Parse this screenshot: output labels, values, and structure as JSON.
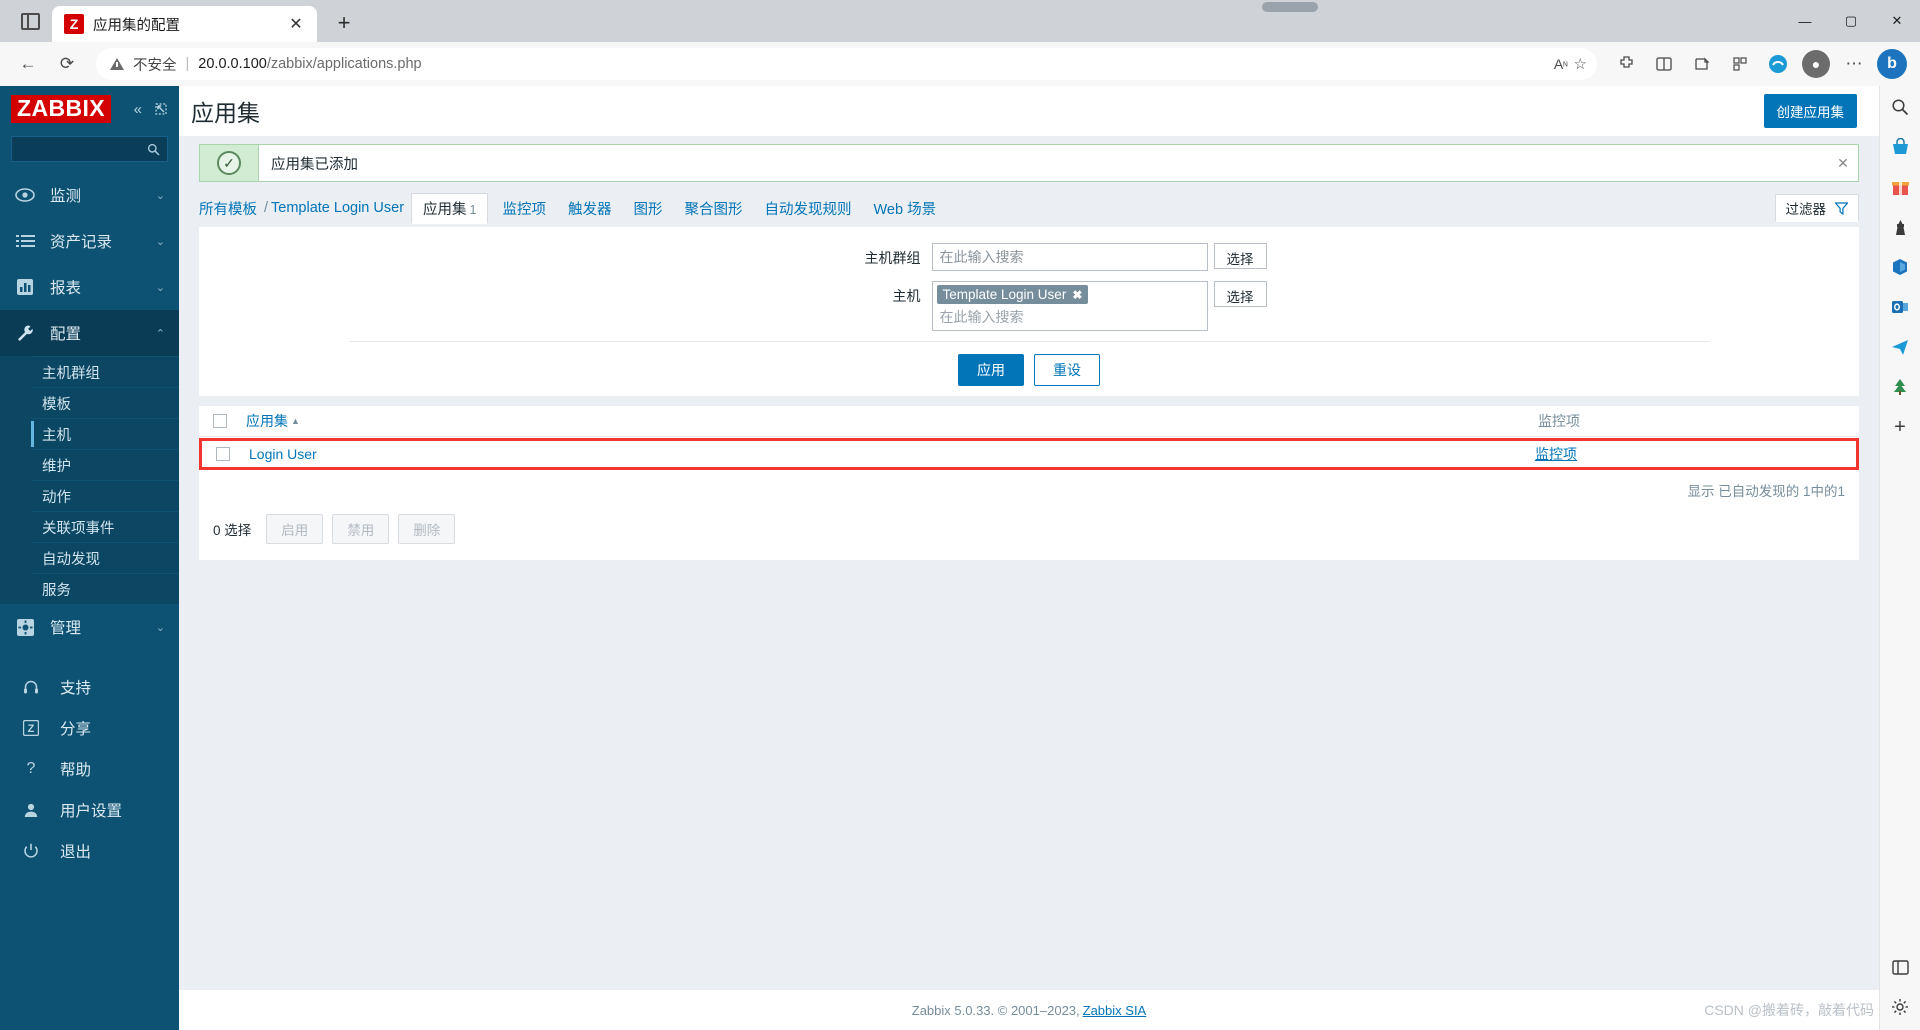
{
  "browser": {
    "tab": {
      "favicon_letter": "Z",
      "title": "应用集的配置",
      "close_label": "✕"
    },
    "newtab_label": "+",
    "window_controls": {
      "minimize": "—",
      "maximize": "▢",
      "close": "✕"
    },
    "nav": {
      "back": "←",
      "reload": "⟳"
    },
    "address": {
      "security_label": "不安全",
      "separator": "|",
      "url_host": "20.0.0.100",
      "url_path": "/zabbix/applications.php"
    },
    "omnibox_icons": [
      "read-aloud-icon",
      "favorite-star-icon"
    ],
    "toolbar_icons": [
      "extensions-icon",
      "split-screen-icon",
      "collections-icon",
      "browser-essentials-icon",
      "copilot-icon"
    ],
    "profile": "avatar",
    "bing_label": "b"
  },
  "sidebar": {
    "logo": "ZABBIX",
    "collapse_icon": "«",
    "expand_icon": "⇱",
    "search": {
      "placeholder": "",
      "value": "",
      "icon": "search-icon"
    },
    "items": [
      {
        "label": "监测",
        "icon": "eye-icon",
        "chevron": "⌄",
        "active": false
      },
      {
        "label": "资产记录",
        "icon": "list-icon",
        "chevron": "⌄",
        "active": false
      },
      {
        "label": "报表",
        "icon": "bar-chart-icon",
        "chevron": "⌄",
        "active": false
      },
      {
        "label": "配置",
        "icon": "wrench-icon",
        "chevron": "⌃",
        "active": true
      }
    ],
    "sub_items": [
      {
        "label": "主机群组",
        "selected": false
      },
      {
        "label": "模板",
        "selected": false
      },
      {
        "label": "主机",
        "selected": true
      },
      {
        "label": "维护",
        "selected": false
      },
      {
        "label": "动作",
        "selected": false
      },
      {
        "label": "关联项事件",
        "selected": false
      },
      {
        "label": "自动发现",
        "selected": false
      },
      {
        "label": "服务",
        "selected": false
      }
    ],
    "admin": {
      "label": "管理",
      "icon": "gear-icon",
      "chevron": "⌄"
    },
    "footer_items": [
      {
        "label": "支持",
        "icon": "headset-icon"
      },
      {
        "label": "分享",
        "icon": "zabbix-square-icon"
      },
      {
        "label": "帮助",
        "icon": "question-icon"
      },
      {
        "label": "用户设置",
        "icon": "user-icon"
      },
      {
        "label": "退出",
        "icon": "power-icon"
      }
    ]
  },
  "header": {
    "title": "应用集",
    "create_button": "创建应用集"
  },
  "message": {
    "text": "应用集已添加",
    "icon": "check-circle-icon",
    "close": "✕"
  },
  "navtabs": {
    "breadcrumb_root": "所有模板",
    "separator": "/",
    "breadcrumb_template": "Template Login User",
    "current_tab": {
      "label": "应用集",
      "count": "1"
    },
    "tabs": [
      "监控项",
      "触发器",
      "图形",
      "聚合图形",
      "自动发现规则",
      "Web 场景"
    ],
    "filter_tab": {
      "label": "过滤器",
      "icon": "funnel-icon"
    }
  },
  "filter": {
    "host_group": {
      "label": "主机群组",
      "placeholder": "在此输入搜索",
      "value": ""
    },
    "host": {
      "label": "主机",
      "placeholder": "在此输入搜索",
      "chips": [
        {
          "label": "Template Login User",
          "remove": "✖"
        }
      ]
    },
    "select_button": "选择",
    "apply_button": "应用",
    "reset_button": "重设"
  },
  "table": {
    "columns": [
      "应用集",
      "监控项"
    ],
    "sort_indicator": "▲",
    "rows": [
      {
        "name": "Login User",
        "items_link": "监控项",
        "highlighted": true
      }
    ],
    "count_text": "显示 已自动发现的 1中的1",
    "selection_text": "0 选择",
    "actions": [
      "启用",
      "禁用",
      "删除"
    ]
  },
  "footer": {
    "text": "Zabbix 5.0.33. © 2001–2023,",
    "link": "Zabbix SIA"
  },
  "watermark": "CSDN @搬着砖，敲着代码",
  "edge_rail": {
    "icons": [
      "search-icon",
      "shopping-icon",
      "gift-icon",
      "game-icon",
      "m365-icon",
      "outlook-icon",
      "send-icon",
      "tree-icon",
      "add-icon"
    ],
    "bottom_icons": [
      "split-pane-icon",
      "settings-icon"
    ]
  },
  "colors": {
    "brand_red": "#d40000",
    "sidebar_bg": "#0d5272",
    "accent_blue": "#0275b8",
    "success_bg": "#d1ecd3",
    "highlight_red": "#f2352e"
  }
}
